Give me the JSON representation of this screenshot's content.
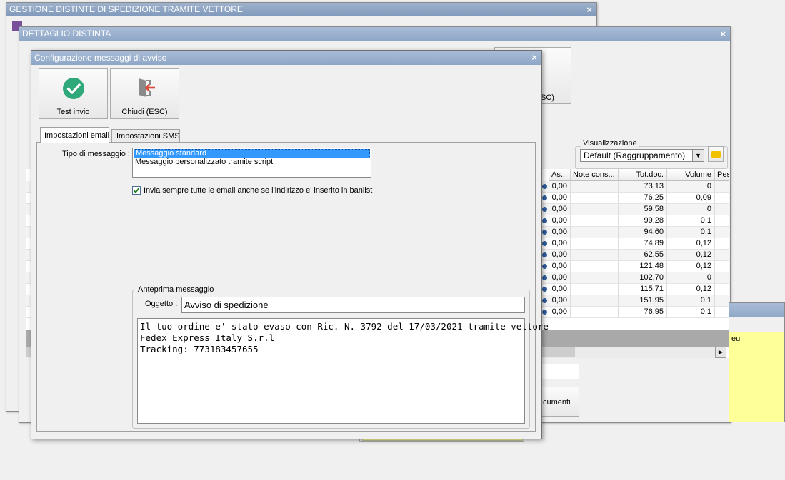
{
  "back_window": {
    "title": "GESTIONE DISTINTE DI SPEDIZIONE TRAMITE VETTORE",
    "close": "×"
  },
  "detail_window": {
    "title": "DETTAGLIO DISTINTA",
    "close": "×",
    "partial_button_label": "SC)",
    "documents_button_label": "cumenti",
    "visualizzazione": {
      "legend": "Visualizzazione",
      "selected": "Default (Raggruppamento)"
    },
    "grid": {
      "columns": [
        "As...",
        "Note cons...",
        "Tot.doc.",
        "Volume",
        "Pes"
      ],
      "rows": [
        {
          "as": "0,00",
          "tot": "73,13",
          "vol": "0"
        },
        {
          "as": "0,00",
          "tot": "76,25",
          "vol": "0,09"
        },
        {
          "as": "0,00",
          "tot": "59,58",
          "vol": "0"
        },
        {
          "as": "0,00",
          "tot": "99,28",
          "vol": "0,1"
        },
        {
          "as": "0,00",
          "tot": "94,60",
          "vol": "0,1"
        },
        {
          "as": "0,00",
          "tot": "74,89",
          "vol": "0,12"
        },
        {
          "as": "0,00",
          "tot": "62,55",
          "vol": "0,12"
        },
        {
          "as": "0,00",
          "tot": "121,48",
          "vol": "0,12"
        },
        {
          "as": "0,00",
          "tot": "102,70",
          "vol": "0"
        },
        {
          "as": "0,00",
          "tot": "115,71",
          "vol": "0,12"
        },
        {
          "as": "0,00",
          "tot": "151,95",
          "vol": "0,1"
        },
        {
          "as": "0,00",
          "tot": "76,95",
          "vol": "0,1"
        }
      ]
    }
  },
  "side_panel": {
    "text": "eu"
  },
  "dialog": {
    "title": "Configurazione messaggi di avviso",
    "close": "×",
    "toolbar": {
      "test_label": "Test invio",
      "close_label": "Chiudi (ESC)"
    },
    "tabs": [
      {
        "label": "Impostazioni email"
      },
      {
        "label": "Impostazioni SMS"
      }
    ],
    "tipo_label": "Tipo di messaggio :",
    "tipo_options": [
      "Messaggio standard",
      "Messaggio personalizzato tramite script"
    ],
    "checkbox_label": "Invia sempre tutte le email anche se l'indirizzo e' inserito in banlist",
    "preview": {
      "legend": "Anteprima messaggio",
      "subject_label": "Oggetto :",
      "subject_value": "Avviso di spedizione",
      "body_lines": [
        "Il tuo ordine e' stato evaso con Ric. N. 3792 del 17/03/2021 tramite vettore",
        "Fedex Express Italy S.r.l",
        "Tracking: 773183457655"
      ]
    }
  },
  "colors": {
    "titlebar": "#8ea7c7",
    "selection": "#3399ff",
    "check_green": "#2fa87a",
    "side_yellow": "#ffff99"
  }
}
